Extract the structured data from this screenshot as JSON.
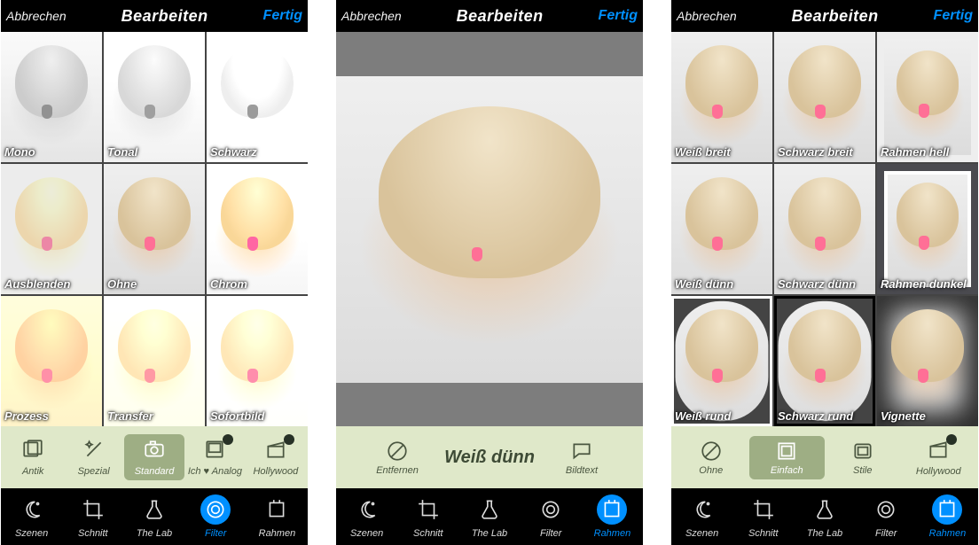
{
  "header": {
    "cancel": "Abbrechen",
    "title": "Bearbeiten",
    "done": "Fertig"
  },
  "nav": {
    "items": [
      {
        "label": "Szenen"
      },
      {
        "label": "Schnitt"
      },
      {
        "label": "The Lab"
      },
      {
        "label": "Filter"
      },
      {
        "label": "Rahmen"
      }
    ]
  },
  "screen1": {
    "filters": [
      {
        "label": "Mono"
      },
      {
        "label": "Tonal"
      },
      {
        "label": "Schwarz"
      },
      {
        "label": "Ausblenden"
      },
      {
        "label": "Ohne"
      },
      {
        "label": "Chrom"
      },
      {
        "label": "Prozess"
      },
      {
        "label": "Transfer"
      },
      {
        "label": "Sofortbild"
      }
    ],
    "cats": [
      {
        "label": "Antik"
      },
      {
        "label": "Spezial"
      },
      {
        "label": "Standard"
      },
      {
        "label": "Ich ♥ Analog"
      },
      {
        "label": "Hollywood"
      }
    ],
    "active_cat": 2,
    "active_nav": 3
  },
  "screen2": {
    "remove": "Entfernen",
    "caption": "Bildtext",
    "current": "Weiß dünn",
    "active_nav": 4
  },
  "screen3": {
    "frames": [
      {
        "label": "Weiß breit"
      },
      {
        "label": "Schwarz breit"
      },
      {
        "label": "Rahmen hell"
      },
      {
        "label": "Weiß dünn"
      },
      {
        "label": "Schwarz dünn"
      },
      {
        "label": "Rahmen dunkel"
      },
      {
        "label": "Weiß rund"
      },
      {
        "label": "Schwarz rund"
      },
      {
        "label": "Vignette"
      }
    ],
    "cats": [
      {
        "label": "Ohne"
      },
      {
        "label": "Einfach"
      },
      {
        "label": "Stile"
      },
      {
        "label": "Hollywood"
      }
    ],
    "active_cat": 1,
    "active_nav": 4
  }
}
